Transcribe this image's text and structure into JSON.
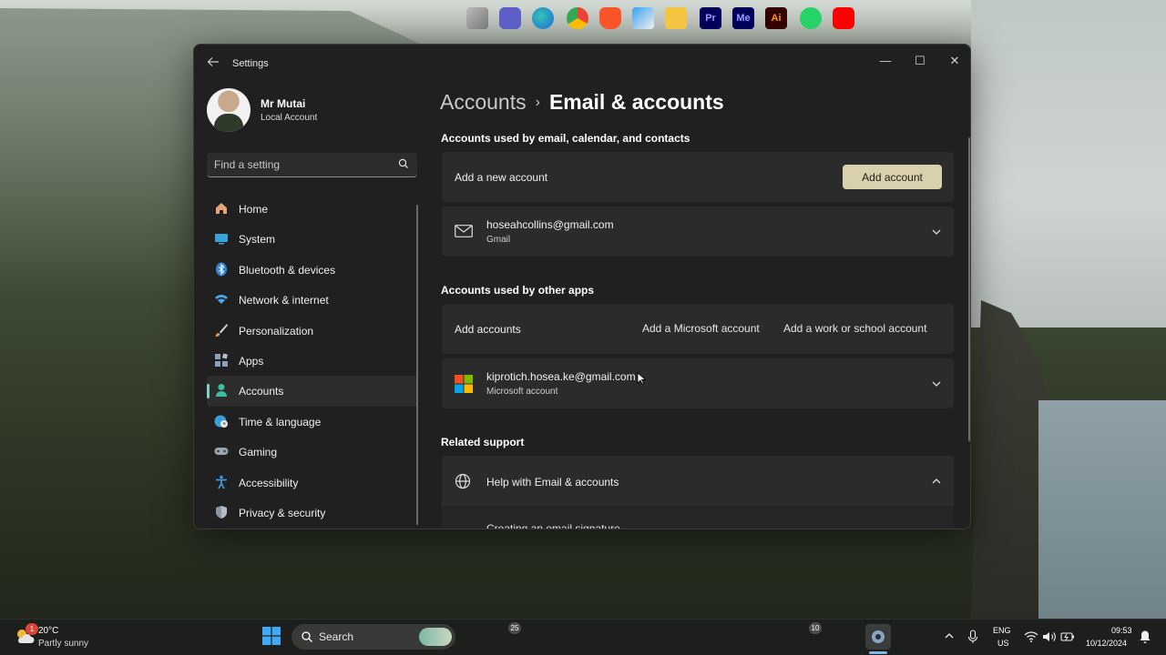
{
  "window": {
    "app_title": "Settings",
    "minimize": "—",
    "maximize": "☐",
    "close": "✕"
  },
  "profile": {
    "name": "Mr Mutai",
    "account_type": "Local Account"
  },
  "search": {
    "placeholder": "Find a setting"
  },
  "sidebar": {
    "items": [
      {
        "label": "Home",
        "icon": "home-icon",
        "color": "#e8a37a"
      },
      {
        "label": "System",
        "icon": "system-icon",
        "color": "#38a3d8"
      },
      {
        "label": "Bluetooth & devices",
        "icon": "bluetooth-icon",
        "color": "#2f86d6"
      },
      {
        "label": "Network & internet",
        "icon": "wifi-icon",
        "color": "#4aa8e8"
      },
      {
        "label": "Personalization",
        "icon": "brush-icon",
        "color": "#e0a070"
      },
      {
        "label": "Apps",
        "icon": "apps-icon",
        "color": "#8aa0b8"
      },
      {
        "label": "Accounts",
        "icon": "person-icon",
        "color": "#3dbfa0",
        "active": true
      },
      {
        "label": "Time & language",
        "icon": "globe-clock-icon",
        "color": "#3aa0d8"
      },
      {
        "label": "Gaming",
        "icon": "gamepad-icon",
        "color": "#9aa3ad"
      },
      {
        "label": "Accessibility",
        "icon": "accessibility-icon",
        "color": "#3a9be0"
      },
      {
        "label": "Privacy & security",
        "icon": "shield-icon",
        "color": "#8c96a0"
      }
    ]
  },
  "breadcrumb": {
    "parent": "Accounts",
    "separator": "›",
    "current": "Email & accounts"
  },
  "sections": {
    "email": {
      "title": "Accounts used by email, calendar, and contacts",
      "add_label": "Add a new account",
      "add_button": "Add account",
      "account": {
        "email": "hoseahcollins@gmail.com",
        "provider": "Gmail"
      }
    },
    "other_apps": {
      "title": "Accounts used by other apps",
      "add_label": "Add accounts",
      "add_microsoft": "Add a Microsoft account",
      "add_work": "Add a work or school account",
      "account": {
        "email": "kiprotich.hosea.ke@gmail.com",
        "provider": "Microsoft account"
      }
    },
    "support": {
      "title": "Related support",
      "help_title": "Help with Email & accounts",
      "first_link": "Creating an email signature"
    }
  },
  "taskbar": {
    "weather_temp": "20°C",
    "weather_desc": "Partly sunny",
    "weather_badge": "1",
    "search_label": "Search",
    "teams_badge": "25",
    "whatsapp_badge": "10",
    "lang_primary": "ENG",
    "lang_secondary": "US",
    "time": "09:53",
    "date": "10/12/2024",
    "premiere_label": "Pr",
    "media_encoder_label": "Me",
    "illustrator_label": "Ai"
  },
  "colors": {
    "accent_button": "#d9d1ad",
    "active_indicator": "#7fd0c6",
    "window_bg": "#202020",
    "card_bg": "#2b2b2b"
  }
}
